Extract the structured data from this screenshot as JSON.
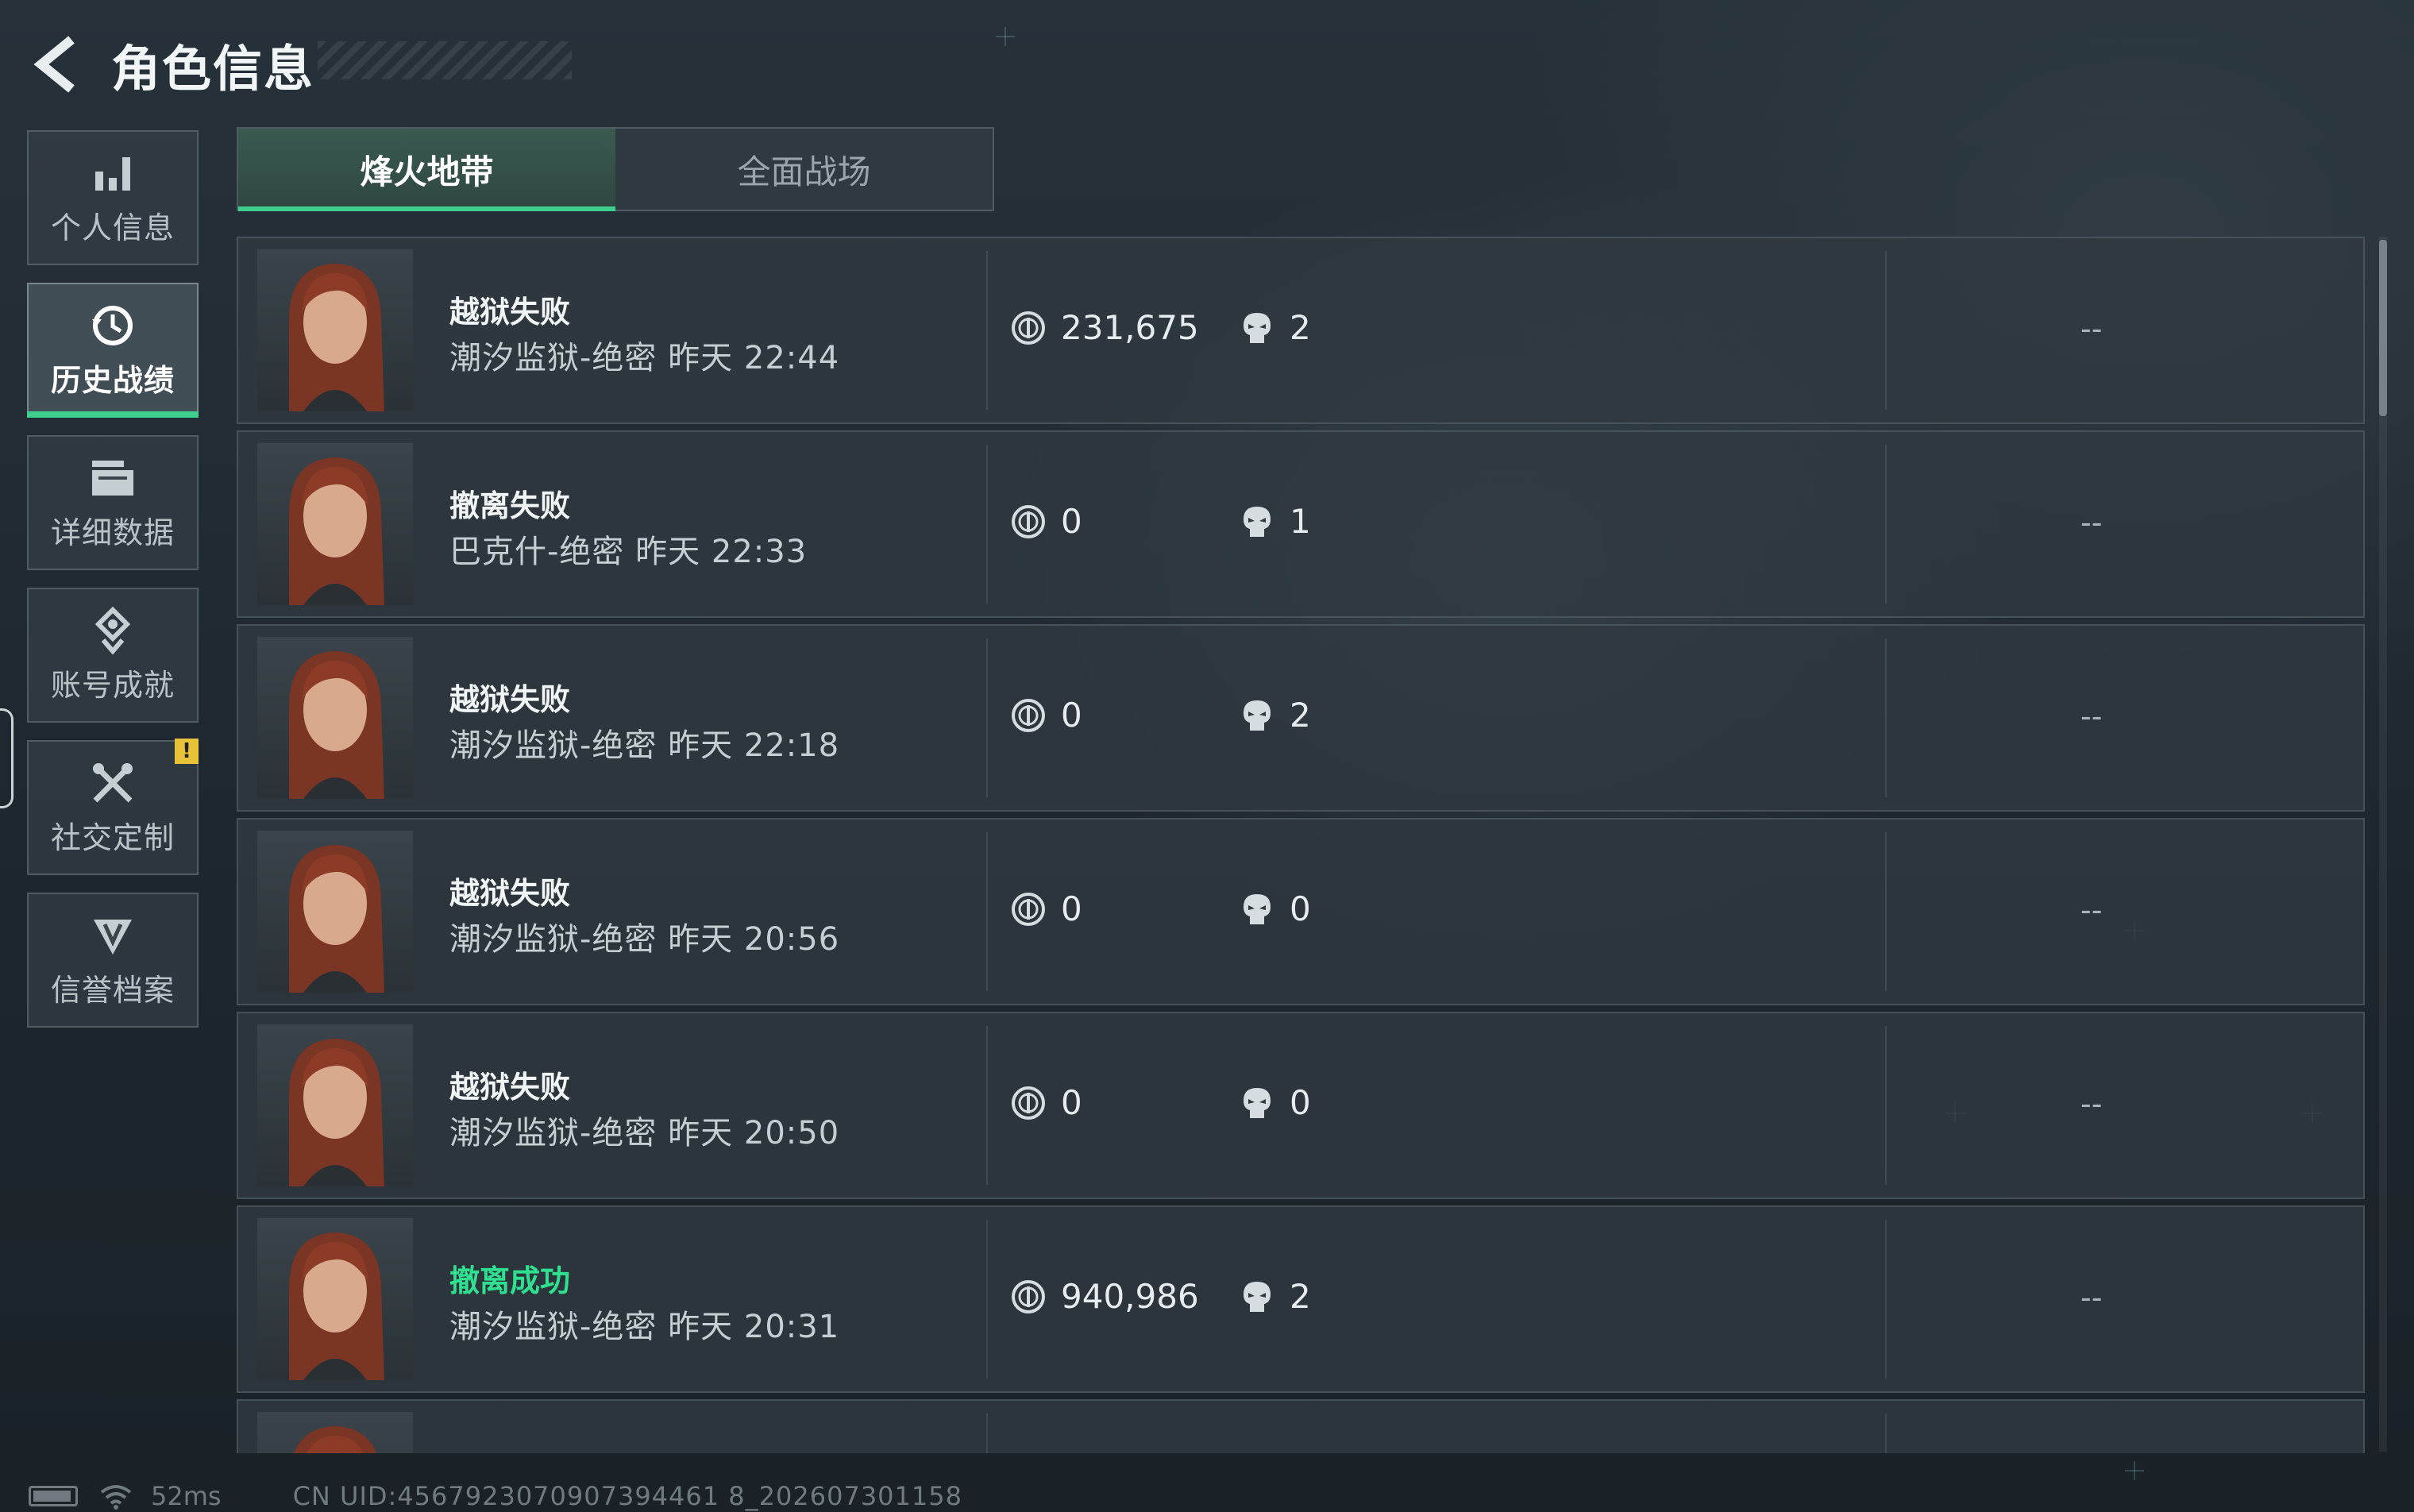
{
  "header": {
    "title": "角色信息",
    "back_icon": "chevron-left-icon"
  },
  "sidebar": {
    "items": [
      {
        "label": "个人信息",
        "icon": "bar-chart-icon",
        "active": false
      },
      {
        "label": "历史战绩",
        "icon": "clock-history-icon",
        "active": true
      },
      {
        "label": "详细数据",
        "icon": "folder-icon",
        "active": false
      },
      {
        "label": "账号成就",
        "icon": "medal-icon",
        "active": false
      },
      {
        "label": "社交定制",
        "icon": "tools-icon",
        "active": false,
        "badge": "!"
      },
      {
        "label": "信誉档案",
        "icon": "shield-emblem-icon",
        "active": false
      }
    ]
  },
  "tabs": [
    {
      "label": "烽火地带",
      "active": true
    },
    {
      "label": "全面战场",
      "active": false
    }
  ],
  "records": [
    {
      "status": "越狱失败",
      "success": false,
      "map": "潮汐监狱-绝密",
      "time": "昨天 22:44",
      "money": "231,675",
      "kills": "2",
      "extra": "--"
    },
    {
      "status": "撤离失败",
      "success": false,
      "map": "巴克什-绝密",
      "time": "昨天 22:33",
      "money": "0",
      "kills": "1",
      "extra": "--"
    },
    {
      "status": "越狱失败",
      "success": false,
      "map": "潮汐监狱-绝密",
      "time": "昨天 22:18",
      "money": "0",
      "kills": "2",
      "extra": "--"
    },
    {
      "status": "越狱失败",
      "success": false,
      "map": "潮汐监狱-绝密",
      "time": "昨天 20:56",
      "money": "0",
      "kills": "0",
      "extra": "--"
    },
    {
      "status": "越狱失败",
      "success": false,
      "map": "潮汐监狱-绝密",
      "time": "昨天 20:50",
      "money": "0",
      "kills": "0",
      "extra": "--"
    },
    {
      "status": "撤离成功",
      "success": true,
      "map": "潮汐监狱-绝密",
      "time": "昨天 20:31",
      "money": "940,986",
      "kills": "2",
      "extra": "--"
    }
  ],
  "footer": {
    "ping": "52ms",
    "uid": "CN UID:4567923070907394461 8_202607301158"
  },
  "colors": {
    "accent": "#3ecf8e",
    "success": "#2ee08f",
    "warning": "#e8c33a"
  }
}
